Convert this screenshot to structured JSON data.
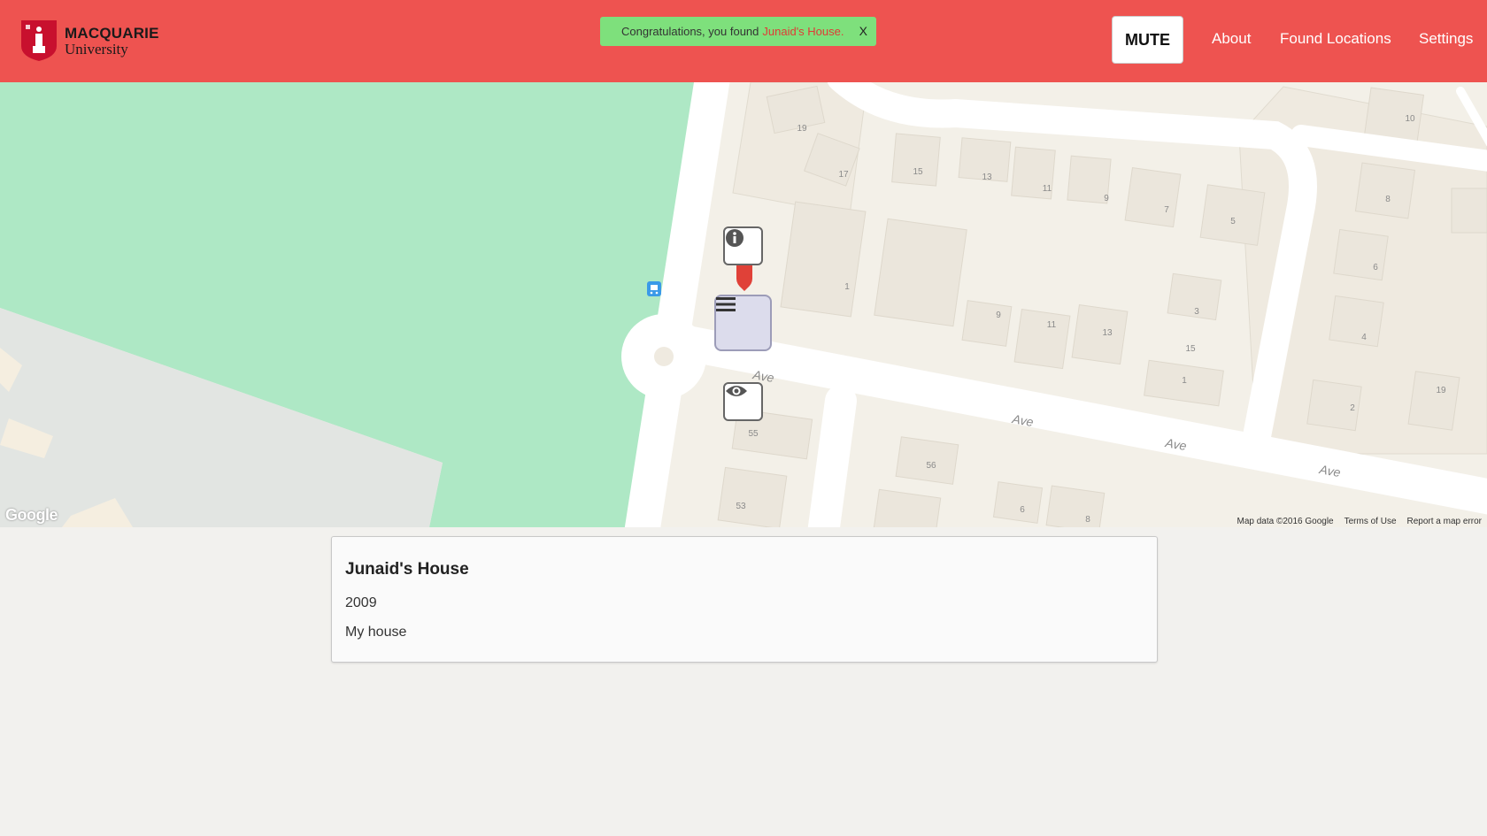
{
  "header": {
    "logo": {
      "name": "MACQUARIE",
      "sub": "University"
    },
    "toast": {
      "prefix": "Congratulations, you found",
      "location": "Junaid's House.",
      "close": "X"
    },
    "mute_label": "MUTE",
    "nav": {
      "about": "About",
      "found": "Found Locations",
      "settings": "Settings"
    }
  },
  "map": {
    "google_logo": "Google",
    "attribution": {
      "data": "Map data ©2016 Google",
      "terms": "Terms of Use",
      "report": "Report a map error"
    },
    "street_labels": [
      "Ave",
      "Ave",
      "Ave",
      "Ave",
      "Ave"
    ],
    "house_numbers": [
      "19",
      "17",
      "15",
      "13",
      "11",
      "9",
      "7",
      "5",
      "10",
      "8",
      "6",
      "4",
      "1",
      "9",
      "11",
      "13",
      "3",
      "15",
      "1",
      "2",
      "19",
      "55",
      "56",
      "53",
      "6",
      "8"
    ],
    "controls": [
      "info-icon",
      "menu-icon",
      "eye-icon",
      "bus-stop-icon",
      "map-pin-icon"
    ],
    "colors": {
      "park": "#aee8c5",
      "road": "#ffffff",
      "land": "#f3f0e8",
      "building": "#ebe6dc"
    }
  },
  "card": {
    "title": "Junaid's House",
    "year": "2009",
    "description": "My house"
  },
  "colors": {
    "header_bg": "#ee5350",
    "toast_bg": "#7ee07c",
    "toast_link": "#e03b36"
  }
}
